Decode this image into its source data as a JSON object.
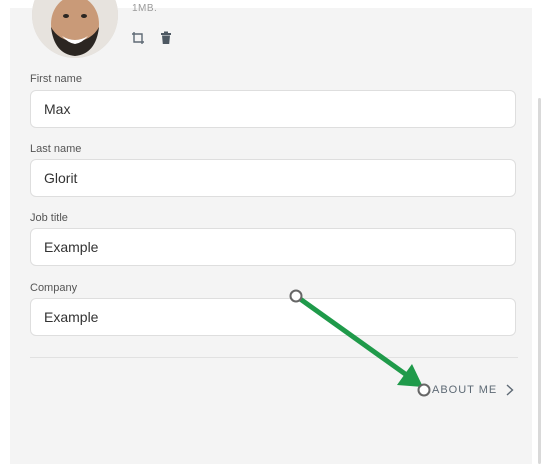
{
  "profile": {
    "upload_hint": "1MB.",
    "avatar_alt": "avatar"
  },
  "fields": {
    "first_name": {
      "label": "First name",
      "value": "Max"
    },
    "last_name": {
      "label": "Last name",
      "value": "Glorit"
    },
    "job_title": {
      "label": "Job title",
      "value": "Example"
    },
    "company": {
      "label": "Company",
      "value": "Example"
    }
  },
  "actions": {
    "about_me_label": "ABOUT ME"
  },
  "colors": {
    "annotation_arrow": "#1f9a4a",
    "accent_text": "#5e6a75"
  }
}
